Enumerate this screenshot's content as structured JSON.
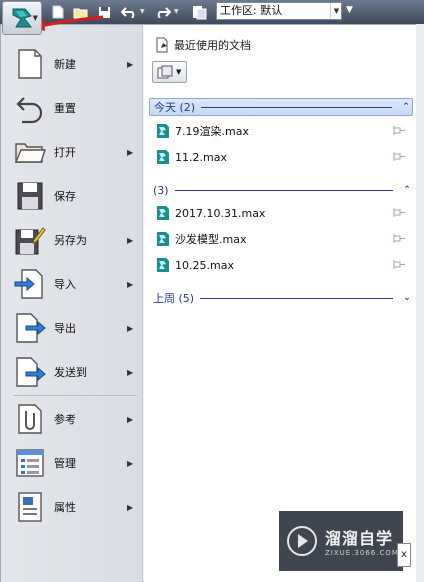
{
  "toolbar": {
    "workspace_label": "工作区: 默认",
    "icons": [
      "new-icon",
      "open-icon",
      "save-icon",
      "undo-icon",
      "redo-icon",
      "project-icon"
    ]
  },
  "menu": {
    "items": [
      {
        "label": "新建",
        "icon": "new-document-icon",
        "arrow": "▶"
      },
      {
        "label": "重置",
        "icon": "reset-icon",
        "arrow": ""
      },
      {
        "label": "打开",
        "icon": "open-folder-icon",
        "arrow": "▶"
      },
      {
        "label": "保存",
        "icon": "floppy-disk-icon",
        "arrow": ""
      },
      {
        "label": "另存为",
        "icon": "save-as-icon",
        "arrow": "▶"
      },
      {
        "label": "导入",
        "icon": "import-icon",
        "arrow": "▶"
      },
      {
        "label": "导出",
        "icon": "export-icon",
        "arrow": "▶"
      },
      {
        "label": "发送到",
        "icon": "send-to-icon",
        "arrow": "▶"
      },
      {
        "label": "参考",
        "icon": "reference-icon",
        "arrow": "▶"
      },
      {
        "label": "管理",
        "icon": "manage-icon",
        "arrow": "▶"
      },
      {
        "label": "属性",
        "icon": "properties-icon",
        "arrow": "▶"
      }
    ]
  },
  "recent": {
    "title": "最近使用的文档",
    "groups": [
      {
        "label": "今天 (2)",
        "chevron": "⌃",
        "files": [
          "7.19渲染.max",
          "11.2.max"
        ]
      },
      {
        "label": "(3)",
        "chevron": "⌃",
        "files": [
          "2017.10.31.max",
          "沙发模型.max",
          "10.25.max"
        ]
      },
      {
        "label": "上周 (5)",
        "chevron": "⌄",
        "files": []
      }
    ]
  },
  "watermark": {
    "title": "溜溜自学",
    "url": "ZIXUE.3066.COM"
  },
  "close_fragment": "x",
  "colors": {
    "accent_blue": "#1e3d8f",
    "file_icon_teal": "#1b8f8f",
    "annotation_red": "#d81e1e"
  }
}
